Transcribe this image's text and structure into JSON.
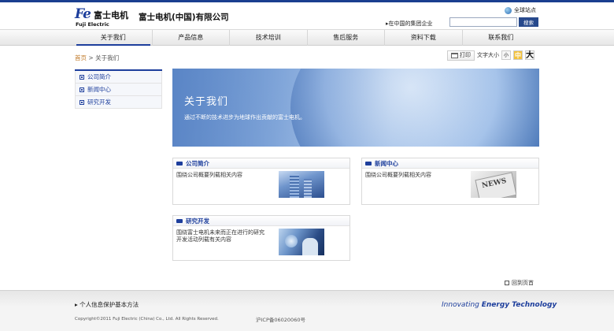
{
  "header": {
    "logo_mark": "Fe",
    "logo_cn": "富士电机",
    "logo_en": "Fuji Electric",
    "company_name": "富士电机(中国)有限公司",
    "global_link": "全球站点",
    "group_link": "▸在中国的集团企业",
    "search_placeholder": "",
    "search_button": "搜索"
  },
  "nav": {
    "items": [
      {
        "label": "关于我们",
        "active": true
      },
      {
        "label": "产品信息"
      },
      {
        "label": "技术培训"
      },
      {
        "label": "售后服务"
      },
      {
        "label": "资料下载"
      },
      {
        "label": "联系我们"
      }
    ]
  },
  "breadcrumb": {
    "home": "首页",
    "separator": ">",
    "current": "关于我们"
  },
  "tools": {
    "print_label": "打印",
    "font_size_label": "文字大小",
    "small": "小",
    "medium": "中",
    "large": "大"
  },
  "sidebar": {
    "items": [
      {
        "label": "公司简介"
      },
      {
        "label": "新闻中心"
      },
      {
        "label": "研究开发"
      }
    ]
  },
  "banner": {
    "title": "关于我们",
    "subtitle": "通过不断的技术进步为地球作出贡献的富士电机。"
  },
  "cards": {
    "profile": {
      "title": "公司简介",
      "text": "围绕公司概要列载相关内容"
    },
    "news": {
      "title": "新闻中心",
      "text": "围绕公司概要列载相关内容",
      "thumb_word": "NEWS"
    },
    "rnd": {
      "title": "研究开发",
      "text_line1": "围绕富士电机未来而正在进行的研究",
      "text_line2": "开发活动列载有关内容"
    }
  },
  "back_to_top": "回到页首",
  "footer": {
    "privacy": "▸ 个人信息保护基本方法",
    "copyright": "Copyright©2011 Fuji Electric (China) Co., Ltd. All Rights Reserved.",
    "icp": "沪ICP备06020060号",
    "tagline_part1": "Innovating",
    "tagline_part2": "Energy Technology"
  },
  "colors": {
    "brand": "#1d3e9c",
    "nav_underline": "#1d3e9c",
    "search_button": "#27498c"
  }
}
